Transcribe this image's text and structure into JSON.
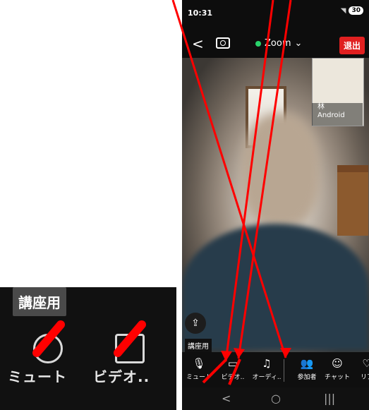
{
  "status_bar": {
    "time": "10:31",
    "battery": "30"
  },
  "header": {
    "back_label": "<",
    "title": "Zoom",
    "leave_label": "退出"
  },
  "video": {
    "participant_name": "林",
    "participant_device": "Android",
    "room_badge": "講座用"
  },
  "toolbar": {
    "items": [
      {
        "label": "ミュート",
        "icon": "mic-icon"
      },
      {
        "label": "ビデオ..",
        "icon": "video-icon"
      },
      {
        "label": "オーディ..",
        "icon": "headphones-icon"
      },
      {
        "label": "参加者",
        "icon": "participants-icon"
      },
      {
        "label": "チャット",
        "icon": "chat-icon"
      },
      {
        "label": "リア",
        "icon": "reaction-icon"
      }
    ]
  },
  "nav": {
    "back": "<",
    "home": "○",
    "recent": "|||"
  },
  "inset": {
    "badge": "講座用",
    "mute_label": "ミュート",
    "video_label": "ビデオ.."
  },
  "colors": {
    "leave_button": "#e02020",
    "secure_indicator": "#29d36b",
    "annotation": "#ff0000"
  }
}
